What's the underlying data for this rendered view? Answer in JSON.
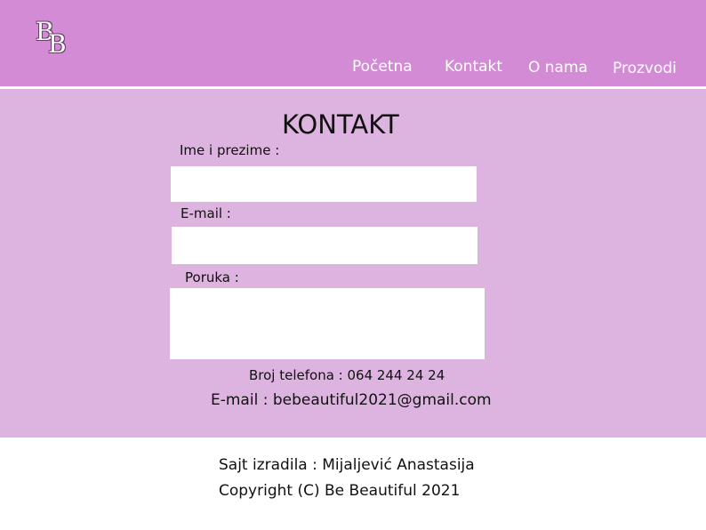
{
  "header": {
    "logo_letters": [
      "B",
      "B"
    ],
    "nav": [
      {
        "label": "Početna"
      },
      {
        "label": "Kontakt"
      },
      {
        "label": "O nama"
      },
      {
        "label": "Prozvodi"
      }
    ]
  },
  "contact": {
    "title": "KONTAKT",
    "fields": [
      {
        "label": "Ime i prezime :",
        "value": "",
        "placeholder": ""
      },
      {
        "label": "E-mail :",
        "value": "",
        "placeholder": ""
      },
      {
        "label": "Poruka :",
        "value": "",
        "placeholder": ""
      }
    ],
    "phone": "Broj telefona : 064 244 24 24",
    "email": "E-mail : bebeautiful2021@gmail.com"
  },
  "footer": {
    "author": "Sajt izradila : Mijaljević Anastasija",
    "copyright": "Copyright (C) Be Beautiful 2021"
  },
  "colors": {
    "header_bg": "#d38bd6",
    "main_bg": "#ddb3df",
    "footer_bg": "#ffffff"
  }
}
